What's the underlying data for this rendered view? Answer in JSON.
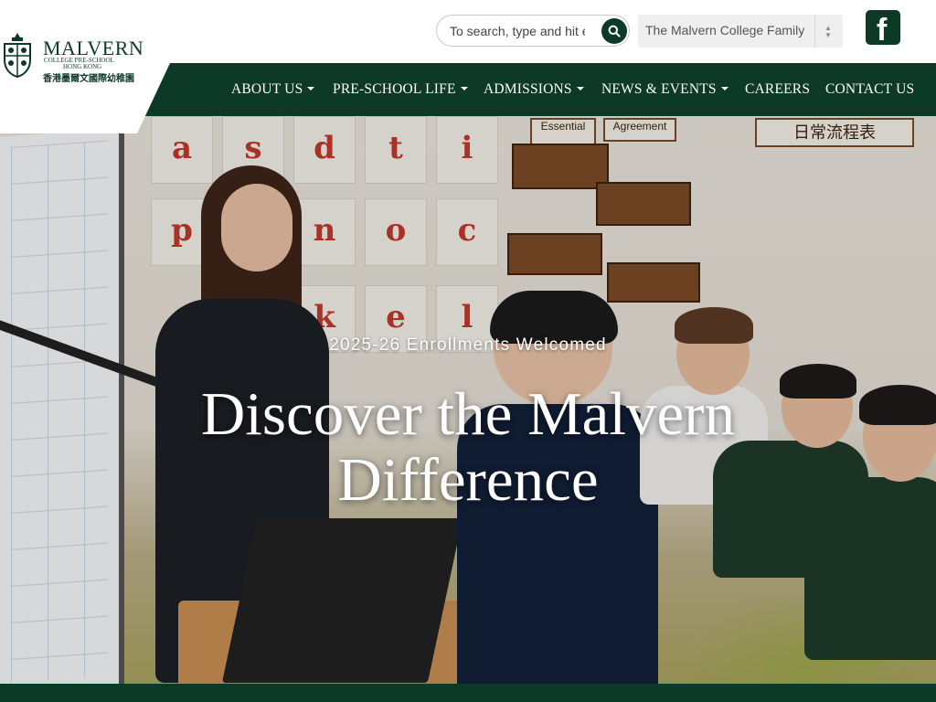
{
  "brand": {
    "name": "MALVERN",
    "line1": "COLLEGE PRE-SCHOOL",
    "line2": "HONG KONG",
    "chinese": "香港墨爾文國際幼稚園"
  },
  "search": {
    "placeholder": "To search, type and hit enter"
  },
  "family_select": {
    "selected": "The Malvern College Family"
  },
  "social": {
    "facebook_glyph": "f"
  },
  "nav": {
    "items": [
      {
        "label": "ABOUT US",
        "dropdown": true
      },
      {
        "label": "PRE-SCHOOL LIFE",
        "dropdown": true
      },
      {
        "label": "ADMISSIONS",
        "dropdown": true
      },
      {
        "label": "NEWS & EVENTS",
        "dropdown": true
      },
      {
        "label": "CAREERS",
        "dropdown": false
      },
      {
        "label": "CONTACT US",
        "dropdown": false
      }
    ]
  },
  "hero": {
    "subtitle": "2025-26 Enrollments Welcomed",
    "headline_line1": "Discover the Malvern",
    "headline_line2": "Difference",
    "wall_letters": [
      "a",
      "s",
      "d",
      "t",
      "i",
      "p",
      "n",
      "o",
      "c",
      "k",
      "e",
      "l"
    ],
    "wall_signs": [
      "Essential",
      "Agreement",
      "日常流程表"
    ]
  },
  "colors": {
    "brand_green": "#0c3a26"
  }
}
